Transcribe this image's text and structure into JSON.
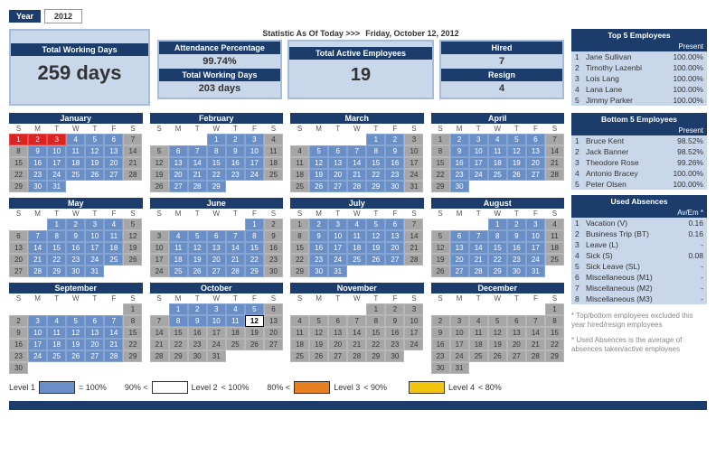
{
  "year": {
    "label": "Year",
    "value": "2012"
  },
  "totalWorkingDays": {
    "title": "Total Working Days",
    "value": "259 days"
  },
  "stats": {
    "asOfLabel": "Statistic As Of Today  >>>",
    "asOfDate": "Friday, October 12, 2012",
    "attendance": {
      "title": "Attendance Percentage",
      "value": "99.74%"
    },
    "workedSoFar": {
      "title": "Total Working Days",
      "value": "203 days"
    },
    "active": {
      "title": "Total Active Employees",
      "value": "19"
    },
    "hired": {
      "title": "Hired",
      "value": "7"
    },
    "resign": {
      "title": "Resign",
      "value": "4"
    }
  },
  "top5": {
    "title": "Top 5 Employees",
    "colLabel": "Present",
    "rows": [
      [
        "1",
        "Jane Sullivan",
        "100.00%"
      ],
      [
        "2",
        "Timothy Lazenbi",
        "100.00%"
      ],
      [
        "3",
        "Lois Lang",
        "100.00%"
      ],
      [
        "4",
        "Lana Lane",
        "100.00%"
      ],
      [
        "5",
        "Jimmy Parker",
        "100.00%"
      ]
    ]
  },
  "bottom5": {
    "title": "Bottom 5 Employees",
    "colLabel": "Present",
    "rows": [
      [
        "1",
        "Bruce Kent",
        "98.52%"
      ],
      [
        "2",
        "Jack Banner",
        "98.52%"
      ],
      [
        "3",
        "Theodore Rose",
        "99.26%"
      ],
      [
        "4",
        "Antonio Bracey",
        "100.00%"
      ],
      [
        "5",
        "Peter Olsen",
        "100.00%"
      ]
    ]
  },
  "absences": {
    "title": "Used Absences",
    "colLabel": "Av/Em *",
    "rows": [
      [
        "1",
        "Vacation (V)",
        "0.16"
      ],
      [
        "2",
        "Business Trip (BT)",
        "0.16"
      ],
      [
        "3",
        "Leave (L)",
        "-"
      ],
      [
        "4",
        "Sick (S)",
        "0.08"
      ],
      [
        "5",
        "Sick Leave (SL)",
        "-"
      ],
      [
        "6",
        "Miscellaneous (M1)",
        "-"
      ],
      [
        "7",
        "Miscellaneous (M2)",
        "-"
      ],
      [
        "8",
        "Miscellaneous (M3)",
        "-"
      ]
    ]
  },
  "footnotes": [
    "* Top/bottom employees excluded this year hired/resign employees",
    "* Used Absences is the average of absences taken/active employees"
  ],
  "legend": [
    {
      "label": "Level 1",
      "op1": "=",
      "th1": "100%",
      "swatch": "#6a8fc7"
    },
    {
      "label": "Level 2",
      "op1": "90%  <",
      "th1": "<  100%",
      "swatch": "#ffffff"
    },
    {
      "label": "Level 3",
      "op1": "80%  <",
      "th1": "<  90%",
      "swatch": "#e67e22"
    },
    {
      "label": "Level 4",
      "op1": "",
      "th1": "<  80%",
      "swatch": "#f1c40f"
    }
  ],
  "dow": [
    "S",
    "M",
    "T",
    "W",
    "T",
    "F",
    "S"
  ],
  "months": [
    {
      "name": "January",
      "start": 0,
      "len": 31,
      "hol": [
        1,
        2,
        3
      ],
      "today": null
    },
    {
      "name": "February",
      "start": 3,
      "len": 29,
      "hol": [],
      "today": null
    },
    {
      "name": "March",
      "start": 4,
      "len": 31,
      "hol": [],
      "today": null
    },
    {
      "name": "April",
      "start": 0,
      "len": 30,
      "hol": [],
      "today": null
    },
    {
      "name": "May",
      "start": 2,
      "len": 31,
      "hol": [],
      "today": null
    },
    {
      "name": "June",
      "start": 5,
      "len": 30,
      "hol": [],
      "today": null
    },
    {
      "name": "July",
      "start": 0,
      "len": 31,
      "hol": [],
      "today": null
    },
    {
      "name": "August",
      "start": 3,
      "len": 31,
      "hol": [],
      "today": null
    },
    {
      "name": "September",
      "start": 6,
      "len": 30,
      "hol": [],
      "today": null
    },
    {
      "name": "October",
      "start": 1,
      "len": 31,
      "hol": [],
      "today": 12
    },
    {
      "name": "November",
      "start": 4,
      "len": 30,
      "hol": [],
      "today": null
    },
    {
      "name": "December",
      "start": 6,
      "len": 31,
      "hol": [],
      "today": null
    }
  ],
  "chart_data": {
    "type": "table",
    "title": "Attendance Dashboard 2012",
    "summary": {
      "year": 2012,
      "total_working_days": 259,
      "as_of_date": "2012-10-12",
      "attendance_pct": 99.74,
      "working_days_so_far": 203,
      "active_employees": 19,
      "hired": 7,
      "resign": 4
    },
    "top5_employees": [
      {
        "name": "Jane Sullivan",
        "present_pct": 100.0
      },
      {
        "name": "Timothy Lazenbi",
        "present_pct": 100.0
      },
      {
        "name": "Lois Lang",
        "present_pct": 100.0
      },
      {
        "name": "Lana Lane",
        "present_pct": 100.0
      },
      {
        "name": "Jimmy Parker",
        "present_pct": 100.0
      }
    ],
    "bottom5_employees": [
      {
        "name": "Bruce Kent",
        "present_pct": 98.52
      },
      {
        "name": "Jack Banner",
        "present_pct": 98.52
      },
      {
        "name": "Theodore Rose",
        "present_pct": 99.26
      },
      {
        "name": "Antonio Bracey",
        "present_pct": 100.0
      },
      {
        "name": "Peter Olsen",
        "present_pct": 100.0
      }
    ],
    "used_absences_avg_per_employee": {
      "Vacation (V)": 0.16,
      "Business Trip (BT)": 0.16,
      "Leave (L)": null,
      "Sick (S)": 0.08,
      "Sick Leave (SL)": null,
      "Miscellaneous (M1)": null,
      "Miscellaneous (M2)": null,
      "Miscellaneous (M3)": null
    },
    "legend_levels": [
      {
        "level": 1,
        "range": "= 100%",
        "color": "#6a8fc7"
      },
      {
        "level": 2,
        "range": "90% < x < 100%",
        "color": "#ffffff"
      },
      {
        "level": 3,
        "range": "80% < x < 90%",
        "color": "#e67e22"
      },
      {
        "level": 4,
        "range": "< 80%",
        "color": "#f1c40f"
      }
    ]
  }
}
